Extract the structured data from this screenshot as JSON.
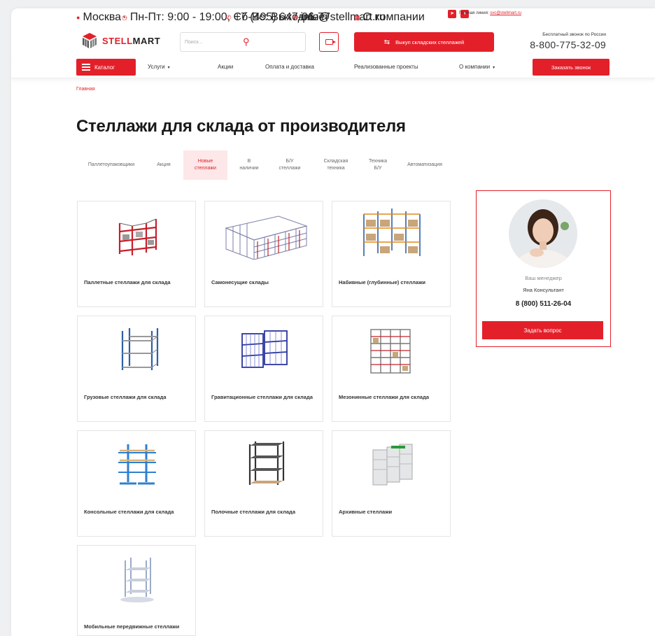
{
  "topbar": {
    "city": "Москва",
    "hours": "Пн-Пт: 9:00 - 19:00, Сб-Вс: Выходные",
    "phone": "+7 (495) 647-06-77",
    "email": "info@stellmart.ru",
    "about": "О компании",
    "hotline_label": "Горячая линия:",
    "hotline_email": "svc@stellmart.ru"
  },
  "header": {
    "logo_part1": "STELL",
    "logo_part2": "MART",
    "search_placeholder": "Поиск...",
    "buyout_label": "Выкуп складских стеллажей",
    "freecall_label": "Бесплатный звонок по России",
    "freecall_phone": "8-800-775-32-09"
  },
  "nav": {
    "catalog": "Каталог",
    "items": [
      "Услуги",
      "Акции",
      "Оплата и доставка",
      "Реализованные проекты",
      "О компании"
    ],
    "callback": "Заказать звонок"
  },
  "breadcrumb": "Главная",
  "page_title": "Стеллажи для склада от производителя",
  "tabs": [
    {
      "label": "Паллетоупаковщики"
    },
    {
      "label": "Акция"
    },
    {
      "label": "Новые\nстеллажи",
      "active": true
    },
    {
      "label": "В\nналичии"
    },
    {
      "label": "Б/У\nстеллажи"
    },
    {
      "label": "Складская\nтехника"
    },
    {
      "label": "Техника\nБ/У"
    },
    {
      "label": "Автоматизация"
    }
  ],
  "products": [
    {
      "title": "Паллетные стеллажи для склада",
      "icon": "pallet-rack-icon"
    },
    {
      "title": "Самонесущие склады",
      "icon": "self-supporting-warehouse-icon"
    },
    {
      "title": "Набивные (глубинные) стеллажи",
      "icon": "drive-in-rack-icon"
    },
    {
      "title": "Грузовые стеллажи для склада",
      "icon": "cargo-rack-icon"
    },
    {
      "title": "Гравитационные стеллажи для склада",
      "icon": "gravity-rack-icon"
    },
    {
      "title": "Мезонинные стеллажи для склада",
      "icon": "mezzanine-rack-icon"
    },
    {
      "title": "Консольные стеллажи для склада",
      "icon": "cantilever-rack-icon"
    },
    {
      "title": "Полочные стеллажи для склада",
      "icon": "shelf-rack-icon"
    },
    {
      "title": "Архивные стеллажи",
      "icon": "archive-rack-icon"
    },
    {
      "title": "Мобильные передвижные стеллажи",
      "icon": "mobile-rack-icon"
    }
  ],
  "manager": {
    "role": "Ваш менеджер",
    "name": "Яна Консультант",
    "phone": "8 (800) 511-26-04",
    "ask_label": "Задать вопрос"
  },
  "colors": {
    "accent": "#e3202a",
    "tab_active_bg": "#fde7e8"
  }
}
